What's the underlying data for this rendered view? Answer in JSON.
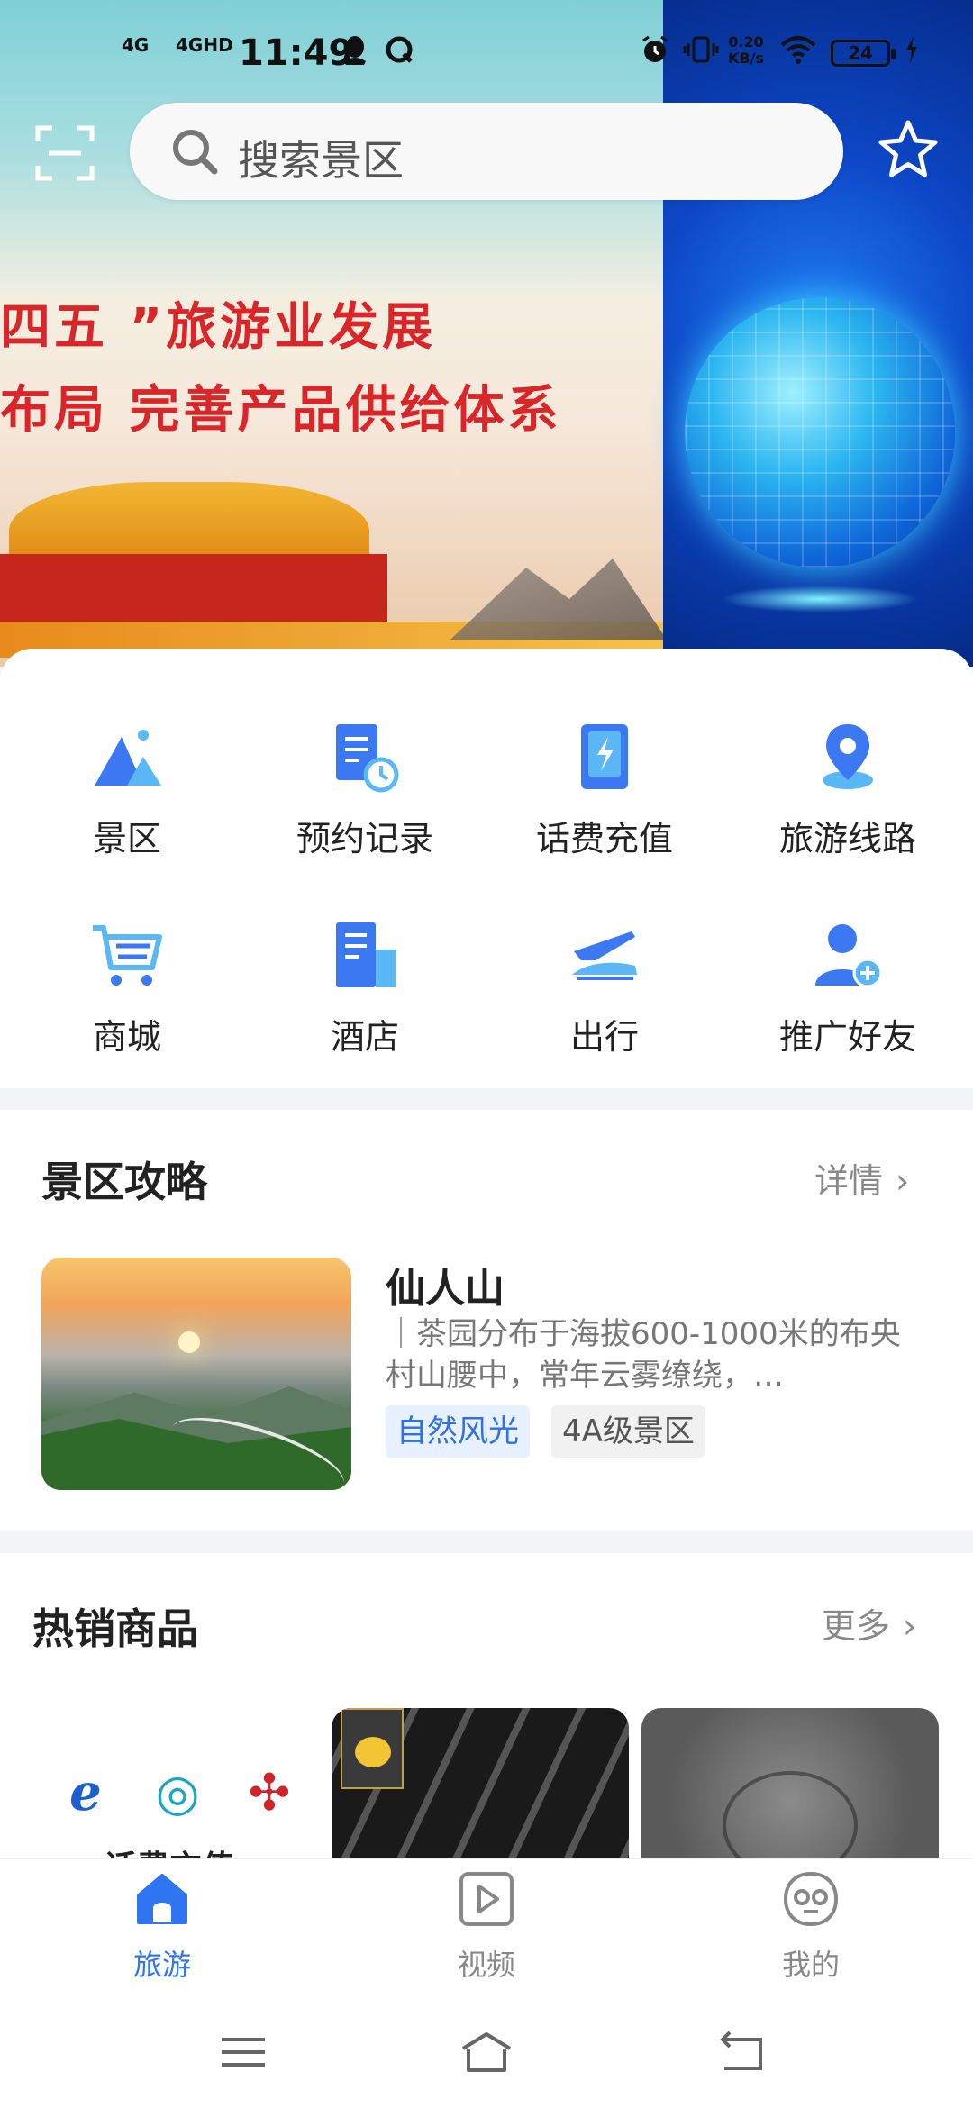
{
  "status_bar": {
    "signal_1": "4G",
    "signal_2": "4GHD",
    "time": "11:49",
    "net_speed_value": "0.20",
    "net_speed_unit": "KB/s",
    "battery": "24"
  },
  "banner": {
    "line1": "四五 ”旅游业发展",
    "line2": "布局 完善产品供给体系"
  },
  "search": {
    "placeholder": "搜索景区"
  },
  "quick_menu": {
    "items": [
      {
        "label": "景区",
        "icon": "mountain-icon"
      },
      {
        "label": "预约记录",
        "icon": "booking-record-icon"
      },
      {
        "label": "话费充值",
        "icon": "phone-recharge-icon"
      },
      {
        "label": "旅游线路",
        "icon": "location-pin-icon"
      },
      {
        "label": "商城",
        "icon": "shopping-cart-icon"
      },
      {
        "label": "酒店",
        "icon": "hotel-building-icon"
      },
      {
        "label": "出行",
        "icon": "airplane-train-icon"
      },
      {
        "label": "推广好友",
        "icon": "add-friend-icon"
      }
    ]
  },
  "scenic_guide": {
    "title": "景区攻略",
    "more": "详情",
    "item": {
      "name": "仙人山",
      "description": "｜茶园分布于海拔600-1000米的布央村山腰中，常年云雾缭绕，…",
      "tags": [
        "自然风光",
        "4A级景区"
      ]
    }
  },
  "hot_products": {
    "title": "热销商品",
    "more": "更多",
    "products": [
      {
        "title": "话费充值"
      },
      {
        "title": ""
      },
      {
        "title": ""
      }
    ]
  },
  "tabbar": {
    "tabs": [
      {
        "label": "旅游",
        "icon": "home-icon",
        "active": true
      },
      {
        "label": "视频",
        "icon": "video-play-icon",
        "active": false
      },
      {
        "label": "我的",
        "icon": "profile-face-icon",
        "active": false
      }
    ]
  },
  "colors": {
    "accent": "#2f74f0",
    "icon_blue": "#3b78f2",
    "icon_light": "#5bb7f5",
    "banner_text": "#d8262a"
  }
}
